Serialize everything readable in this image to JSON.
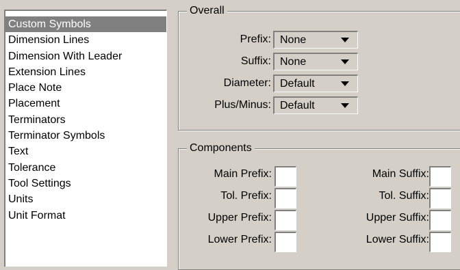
{
  "categories": {
    "items": [
      "Custom Symbols",
      "Dimension Lines",
      "Dimension With Leader",
      "Extension Lines",
      "Place Note",
      "Placement",
      "Terminators",
      "Terminator Symbols",
      "Text",
      "Tolerance",
      "Tool Settings",
      "Units",
      "Unit Format"
    ],
    "selected": "Custom Symbols"
  },
  "overall": {
    "title": "Overall",
    "prefix_label": "Prefix:",
    "prefix_value": "None",
    "suffix_label": "Suffix:",
    "suffix_value": "None",
    "diameter_label": "Diameter:",
    "diameter_value": "Default",
    "plusminus_label": "Plus/Minus:",
    "plusminus_value": "Default"
  },
  "components": {
    "title": "Components",
    "main_prefix": "Main Prefix:",
    "main_suffix": "Main Suffix:",
    "tol_prefix": "Tol. Prefix:",
    "tol_suffix": "Tol. Suffix:",
    "upper_prefix": "Upper Prefix:",
    "upper_suffix": "Upper Suffix:",
    "lower_prefix": "Lower Prefix:",
    "lower_suffix": "Lower Suffix:"
  }
}
